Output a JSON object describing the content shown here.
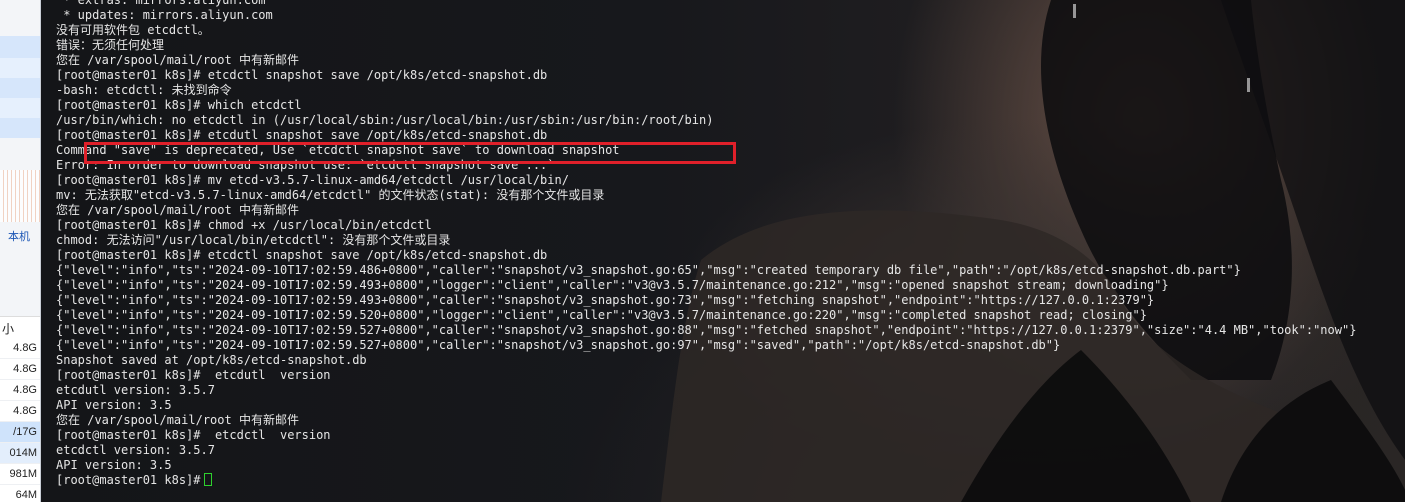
{
  "left_panel": {
    "label": "本机",
    "size_header": "小",
    "sizes": [
      "4.8G",
      "4.8G",
      "4.8G",
      "4.8G",
      "/17G",
      "014M",
      "981M",
      "64M"
    ]
  },
  "terminal": {
    "lines": [
      " * extras: mirrors.aliyun.com",
      " * updates: mirrors.aliyun.com",
      "没有可用软件包 etcdctl。",
      "错误：无须任何处理",
      "您在 /var/spool/mail/root 中有新邮件",
      "[root@master01 k8s]# etcdctl snapshot save /opt/k8s/etcd-snapshot.db",
      "-bash: etcdctl: 未找到命令",
      "[root@master01 k8s]# which etcdctl",
      "/usr/bin/which: no etcdctl in (/usr/local/sbin:/usr/local/bin:/usr/sbin:/usr/bin:/root/bin)",
      "[root@master01 k8s]# etcdutl snapshot save /opt/k8s/etcd-snapshot.db",
      "Command \"save\" is deprecated, Use `etcdctl snapshot save` to download snapshot",
      "Error: In order to download snapshot use: `etcdctl snapshot save ...`",
      "[root@master01 k8s]# mv etcd-v3.5.7-linux-amd64/etcdctl /usr/local/bin/",
      "mv: 无法获取\"etcd-v3.5.7-linux-amd64/etcdctl\" 的文件状态(stat): 没有那个文件或目录",
      "您在 /var/spool/mail/root 中有新邮件",
      "[root@master01 k8s]# chmod +x /usr/local/bin/etcdctl",
      "chmod: 无法访问\"/usr/local/bin/etcdctl\": 没有那个文件或目录",
      "[root@master01 k8s]# etcdctl snapshot save /opt/k8s/etcd-snapshot.db",
      "{\"level\":\"info\",\"ts\":\"2024-09-10T17:02:59.486+0800\",\"caller\":\"snapshot/v3_snapshot.go:65\",\"msg\":\"created temporary db file\",\"path\":\"/opt/k8s/etcd-snapshot.db.part\"}",
      "{\"level\":\"info\",\"ts\":\"2024-09-10T17:02:59.493+0800\",\"logger\":\"client\",\"caller\":\"v3@v3.5.7/maintenance.go:212\",\"msg\":\"opened snapshot stream; downloading\"}",
      "{\"level\":\"info\",\"ts\":\"2024-09-10T17:02:59.493+0800\",\"caller\":\"snapshot/v3_snapshot.go:73\",\"msg\":\"fetching snapshot\",\"endpoint\":\"https://127.0.0.1:2379\"}",
      "{\"level\":\"info\",\"ts\":\"2024-09-10T17:02:59.520+0800\",\"logger\":\"client\",\"caller\":\"v3@v3.5.7/maintenance.go:220\",\"msg\":\"completed snapshot read; closing\"}",
      "{\"level\":\"info\",\"ts\":\"2024-09-10T17:02:59.527+0800\",\"caller\":\"snapshot/v3_snapshot.go:88\",\"msg\":\"fetched snapshot\",\"endpoint\":\"https://127.0.0.1:2379\",\"size\":\"4.4 MB\",\"took\":\"now\"}",
      "{\"level\":\"info\",\"ts\":\"2024-09-10T17:02:59.527+0800\",\"caller\":\"snapshot/v3_snapshot.go:97\",\"msg\":\"saved\",\"path\":\"/opt/k8s/etcd-snapshot.db\"}",
      "Snapshot saved at /opt/k8s/etcd-snapshot.db",
      "[root@master01 k8s]#  etcdutl  version",
      "etcdutl version: 3.5.7",
      "API version: 3.5",
      "您在 /var/spool/mail/root 中有新邮件",
      "[root@master01 k8s]#  etcdctl  version",
      "etcdctl version: 3.5.7",
      "API version: 3.5"
    ],
    "prompt": "[root@master01 k8s]#",
    "colors": {
      "text": "#e6e6e6",
      "background": "#15161a",
      "highlight_border": "#e0202a",
      "cursor": "#2ed12e"
    }
  }
}
